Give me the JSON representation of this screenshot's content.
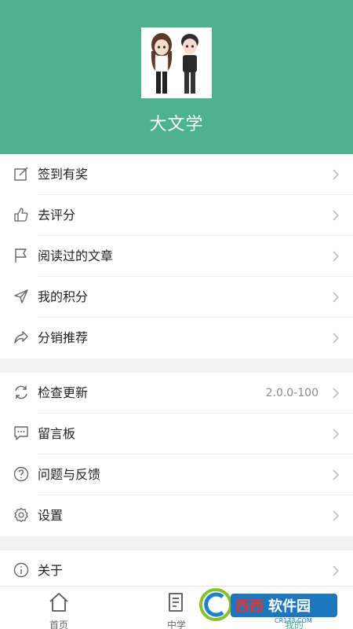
{
  "header": {
    "title": "大文学"
  },
  "menu1": [
    {
      "label": "签到有奖",
      "icon": "edit-icon"
    },
    {
      "label": "去评分",
      "icon": "thumb-up-icon"
    },
    {
      "label": "阅读过的文章",
      "icon": "flag-icon"
    },
    {
      "label": "我的积分",
      "icon": "send-icon"
    },
    {
      "label": "分销推荐",
      "icon": "share-icon"
    }
  ],
  "menu2": [
    {
      "label": "检查更新",
      "icon": "refresh-icon",
      "value": "2.0.0-100"
    },
    {
      "label": "留言板",
      "icon": "message-icon"
    },
    {
      "label": "问题与反馈",
      "icon": "question-icon"
    },
    {
      "label": "设置",
      "icon": "gear-icon"
    }
  ],
  "menu3": [
    {
      "label": "关于",
      "icon": "info-icon"
    }
  ],
  "tabs": [
    {
      "label": "首页",
      "icon": "home-icon"
    },
    {
      "label": "中学",
      "icon": "document-icon"
    },
    {
      "label": "我的",
      "icon": "user-icon",
      "active": true
    }
  ],
  "colors": {
    "accent": "#4db38c",
    "background": "#f2f2f2"
  },
  "watermark": {
    "text": "西西软件园",
    "sub": "CR173.COM"
  }
}
